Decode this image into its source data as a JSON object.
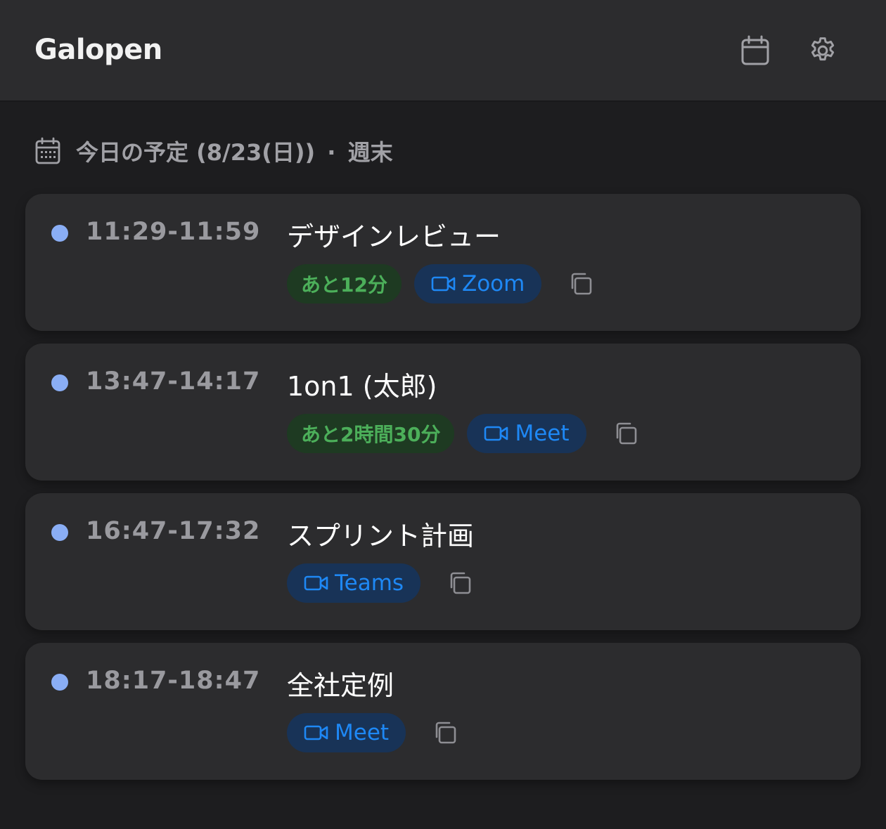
{
  "header": {
    "title": "Galopen",
    "calendar_icon": "calendar-icon",
    "settings_icon": "gear-icon"
  },
  "section": {
    "icon": "calendar-icon",
    "title": "今日の予定 (8/23(日))",
    "separator": "·",
    "suffix": "週末"
  },
  "colors": {
    "dot": "#8aaef5",
    "countdown_bg": "#1e3a22",
    "countdown_text": "#4caf5a",
    "meeting_bg": "#183357",
    "meeting_text": "#1e88f5"
  },
  "events": [
    {
      "time": "11:29-11:59",
      "title": "デザインレビュー",
      "countdown": "あと12分",
      "platform": "Zoom",
      "video_icon": "video-camera-icon",
      "copy_icon": "copy-icon"
    },
    {
      "time": "13:47-14:17",
      "title": "1on1 (太郎)",
      "countdown": "あと2時間30分",
      "platform": "Meet",
      "video_icon": "video-camera-icon",
      "copy_icon": "copy-icon"
    },
    {
      "time": "16:47-17:32",
      "title": "スプリント計画",
      "countdown": null,
      "platform": "Teams",
      "video_icon": "video-camera-icon",
      "copy_icon": "copy-icon"
    },
    {
      "time": "18:17-18:47",
      "title": "全社定例",
      "countdown": null,
      "platform": "Meet",
      "video_icon": "video-camera-icon",
      "copy_icon": "copy-icon"
    }
  ]
}
